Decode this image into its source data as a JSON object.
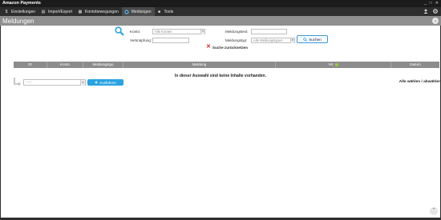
{
  "window": {
    "title": "Amazon Payments",
    "controls": [
      "_",
      "□",
      "✕"
    ]
  },
  "nav": {
    "items": [
      {
        "label": "Einstellungen",
        "icon": "dollar-icon",
        "glyph": "$"
      },
      {
        "label": "Import/Export",
        "icon": "document-icon",
        "glyph": "▤"
      },
      {
        "label": "Kontobewegungen",
        "icon": "grid-icon",
        "glyph": "▦"
      },
      {
        "label": "Meldungen",
        "icon": "chat-icon",
        "glyph": "●"
      },
      {
        "label": "Tools",
        "icon": "tools-icon",
        "glyph": "■"
      }
    ],
    "active": "Meldungen"
  },
  "page": {
    "title": "Meldungen"
  },
  "filter": {
    "konto_label": "Konto:",
    "konto_value": "Alle Konten",
    "verknuepfung_label": "Verknüpfung:",
    "meldungstext_label": "Meldungstext:",
    "meldungstyp_label": "Meldungstyp:",
    "meldungstyp_value": "Alle Meldungstypen",
    "search_button": "Suchen",
    "reset_label": "Suche zurücksetzen"
  },
  "table": {
    "columns": [
      "ID",
      "Konto",
      "Meldungstyp",
      "Meldung",
      "VK",
      "Datum"
    ],
    "empty_message": "In dieser Auswahl sind keine Inhalte vorhanden."
  },
  "actions": {
    "select_placeholder": "-----",
    "run_button": "Ausführen",
    "select_all": "Alle wählen",
    "separator": " / ",
    "deselect_all": "abwählen"
  },
  "colors": {
    "accent": "#2aa3e0",
    "header": "#8c8c8c",
    "nav": "#2e2e2e",
    "reset": "#e02020"
  }
}
